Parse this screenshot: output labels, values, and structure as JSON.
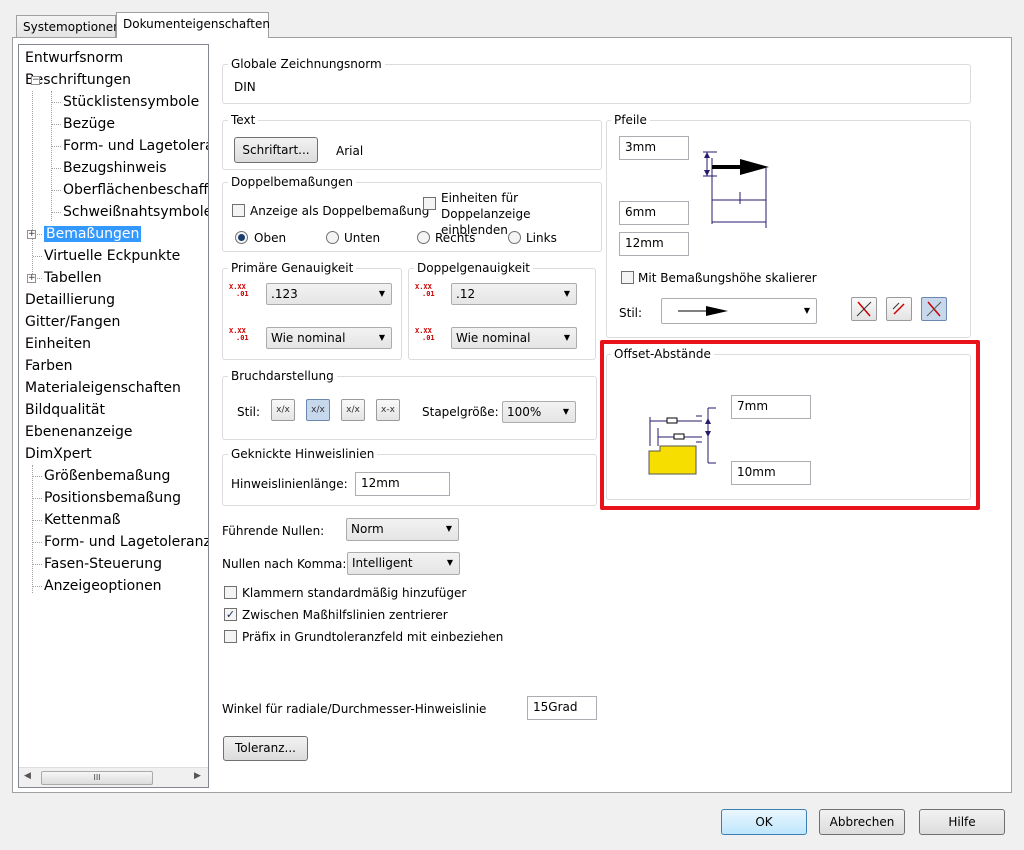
{
  "tabs": {
    "system": "Systemoptionen",
    "document": "Dokumenteigenschaften"
  },
  "tree": [
    {
      "label": "Entwurfsnorm"
    },
    {
      "label": "Beschriftungen",
      "expander": "−"
    },
    {
      "label": "Stücklistensymbole"
    },
    {
      "label": "Bezüge"
    },
    {
      "label": "Form- und Lagetoleranz"
    },
    {
      "label": "Bezugshinweis"
    },
    {
      "label": "Oberflächenbeschaffenheit"
    },
    {
      "label": "Schweißnahtsymbole"
    },
    {
      "label": "Bemaßungen",
      "expander": "+",
      "selected": true
    },
    {
      "label": "Virtuelle Eckpunkte"
    },
    {
      "label": "Tabellen",
      "expander": "+"
    },
    {
      "label": "Detaillierung"
    },
    {
      "label": "Gitter/Fangen"
    },
    {
      "label": "Einheiten"
    },
    {
      "label": "Farben"
    },
    {
      "label": "Materialeigenschaften"
    },
    {
      "label": "Bildqualität"
    },
    {
      "label": "Ebenenanzeige"
    },
    {
      "label": "DimXpert"
    },
    {
      "label": "Größenbemaßung"
    },
    {
      "label": "Positionsbemaßung"
    },
    {
      "label": "Kettenmaß"
    },
    {
      "label": "Form- und Lagetoleranz"
    },
    {
      "label": "Fasen-Steuerung"
    },
    {
      "label": "Anzeigeoptionen"
    }
  ],
  "scroll": {
    "thumb_label": "III",
    "left": "◀",
    "right": "▶"
  },
  "global_norm": {
    "label": "Globale Zeichnungsnorm",
    "value": "DIN"
  },
  "text": {
    "label": "Text",
    "font_button": "Schriftart...",
    "font_value": "Arial"
  },
  "dual": {
    "label": "Doppelbemaßungen",
    "show": "Anzeige als Doppelbemaßung",
    "units": "Einheiten für Doppelanzeige einblenden",
    "show_checked": false,
    "units_checked": false,
    "positions": [
      {
        "label": "Oben",
        "checked": true
      },
      {
        "label": "Unten",
        "checked": false
      },
      {
        "label": "Rechts",
        "checked": false
      },
      {
        "label": "Links",
        "checked": false
      }
    ]
  },
  "primary": {
    "label": "Primäre Genauigkeit",
    "value1": ".123",
    "value2": "Wie nominal"
  },
  "secondary": {
    "label": "Doppelgenauigkeit",
    "value1": ".12",
    "value2": "Wie nominal"
  },
  "precision_icon": {
    "top": "X.XX",
    "dot": ".01"
  },
  "break": {
    "label": "Bruchdarstellung",
    "style_label": "Stil:",
    "stack_label": "Stapelgröße:",
    "stack_value": "100%",
    "style_icons": [
      "x/x",
      "x/x",
      "x/x",
      "x-x"
    ]
  },
  "leader": {
    "label": "Geknickte Hinweislinien",
    "length_label": "Hinweislinienlänge:",
    "length_value": "12mm"
  },
  "arrows": {
    "label": "Pfeile",
    "v1": "3mm",
    "v2": "6mm",
    "v3": "12mm",
    "scale_label": "Mit Bemaßungshöhe skalierer",
    "scale_checked": false,
    "style_label": "Stil:"
  },
  "offset": {
    "label": "Offset-Abstände",
    "v1": "7mm",
    "v2": "10mm",
    "highlight": "#e8121a"
  },
  "leading_zeros": {
    "label": "Führende Nullen:",
    "value": "Norm"
  },
  "trailing_zeros": {
    "label": "Nullen nach Komma:",
    "value": "Intelligent"
  },
  "checks": [
    {
      "label": "Klammern standardmäßig hinzufüger",
      "checked": false
    },
    {
      "label": "Zwischen Maßhilfslinien zentrierer",
      "checked": true
    },
    {
      "label": "Präfix in Grundtoleranzfeld mit einbeziehen",
      "checked": false
    }
  ],
  "angle": {
    "label": "Winkel für radiale/Durchmesser-Hinweislinie",
    "value": "15Grad"
  },
  "tolerance_button": "Toleranz...",
  "buttons": {
    "ok": "OK",
    "cancel": "Abbrechen",
    "help": "Hilfe"
  }
}
